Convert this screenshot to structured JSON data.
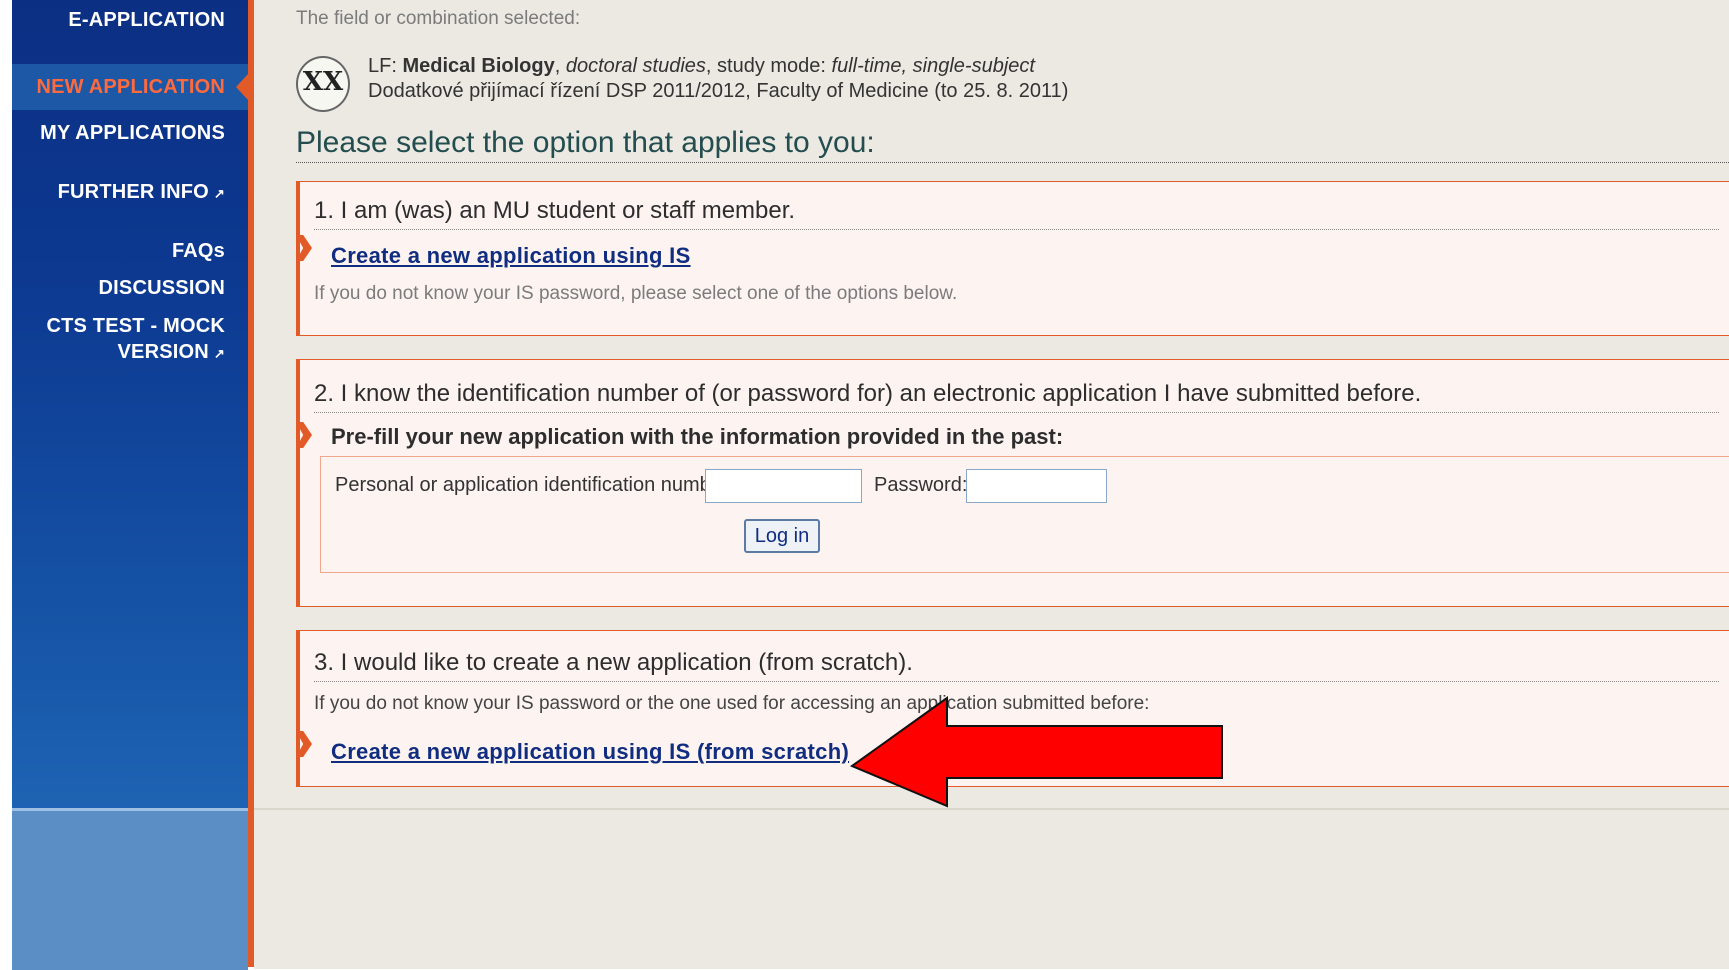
{
  "sidebar": {
    "items": [
      {
        "label": "E-APPLICATION"
      },
      {
        "label": "NEW APPLICATION"
      },
      {
        "label": "MY APPLICATIONS"
      },
      {
        "label": "FURTHER INFO",
        "icon": "external-link-icon"
      },
      {
        "label": "FAQs"
      },
      {
        "label": "DISCUSSION"
      },
      {
        "label_line1": "CTS TEST - MOCK",
        "label_line2": "VERSION",
        "icon": "external-link-icon"
      }
    ]
  },
  "field": {
    "label": "The field or combination selected:",
    "faculty_code": "LF:",
    "programme": "Medical Biology",
    "sep1": ",",
    "study_type": "doctoral studies",
    "mode_label": ", study mode:",
    "mode": "full-time, single-subject",
    "admission": "Dodatkové přijímací řízení DSP 2011/2012, Faculty of Medicine (to 25. 8. 2011)",
    "logo_text": "XX"
  },
  "heading": "Please select the option that applies to you:",
  "option1": {
    "title": "1. I am (was) an MU student or staff member.",
    "link": "Create a new application using IS",
    "hint": "If you do not know your IS password, please select one of the options below."
  },
  "option2": {
    "title": "2. I know the identification number of (or password for) an electronic application I have submitted before.",
    "subhead": "Pre-fill your new application with the information provided in the past:",
    "id_label": "Personal or application identification number:",
    "id_value": "",
    "password_label": "Password:",
    "password_value": "",
    "login_button": "Log in"
  },
  "option3": {
    "title": "3. I would like to create a new application (from scratch).",
    "hint": "If you do not know your IS password or the one used for accessing an application submitted before:",
    "link": "Create a new application using IS (from scratch)"
  },
  "colors": {
    "sidebar": "#0d3a92",
    "accent": "#e35a29",
    "link": "#102d80",
    "arrow": "#ff0000"
  }
}
